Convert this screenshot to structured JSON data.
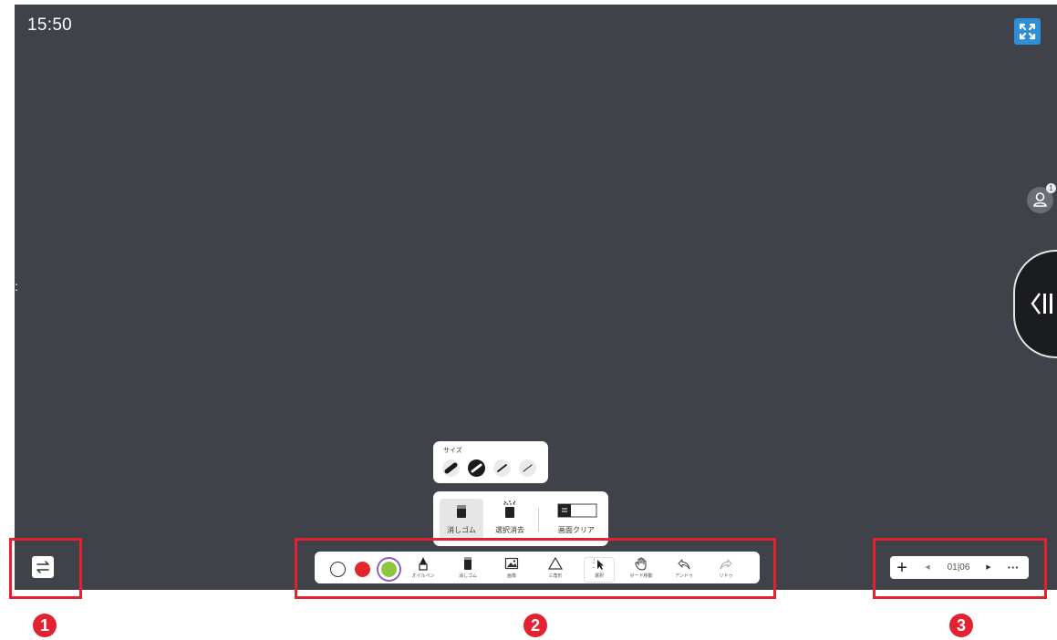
{
  "status": {
    "clock": "15:50",
    "user_count": "1",
    "side_marker": ":"
  },
  "icons": {
    "fullscreen": "fullscreen-icon",
    "user": "user-icon",
    "side_handle": "panel-collapse-icon",
    "switch": "switch-arrows-icon"
  },
  "size_popup": {
    "title": "サイズ",
    "sizes": [
      "extra-thick",
      "thick",
      "medium",
      "thin"
    ],
    "selected_index": 1
  },
  "eraser_popup": {
    "options": [
      {
        "label": "消しゴム",
        "icon": "eraser-icon",
        "selected": true
      },
      {
        "label": "選択消去",
        "icon": "selective-erase-icon",
        "selected": false
      },
      {
        "label": "画面クリア",
        "icon": "clear-screen-icon",
        "selected": false
      }
    ]
  },
  "toolbar": {
    "colors": [
      "#ffffff",
      "#e2262b",
      "#8dc63f"
    ],
    "selected_color_index": 2,
    "tools": [
      {
        "label": "オイルペン",
        "icon": "oil-pen-icon"
      },
      {
        "label": "消しゴム",
        "icon": "eraser-icon"
      },
      {
        "label": "画像",
        "icon": "image-icon"
      },
      {
        "label": "三角形",
        "icon": "triangle-icon"
      },
      {
        "label": "選択",
        "icon": "select-icon"
      },
      {
        "label": "ボード移動",
        "icon": "hand-icon"
      },
      {
        "label": "アンドゥ",
        "icon": "undo-icon"
      },
      {
        "label": "リドゥ",
        "icon": "redo-icon"
      }
    ]
  },
  "pager": {
    "add": "+",
    "prev": "◀",
    "count": "01|06",
    "next": "▶",
    "more": "···"
  },
  "callouts": [
    "1",
    "2",
    "3"
  ],
  "colors": {
    "frame": "#e32231",
    "background": "#3f4249",
    "fullscreen_button": "#2e8fd6"
  }
}
